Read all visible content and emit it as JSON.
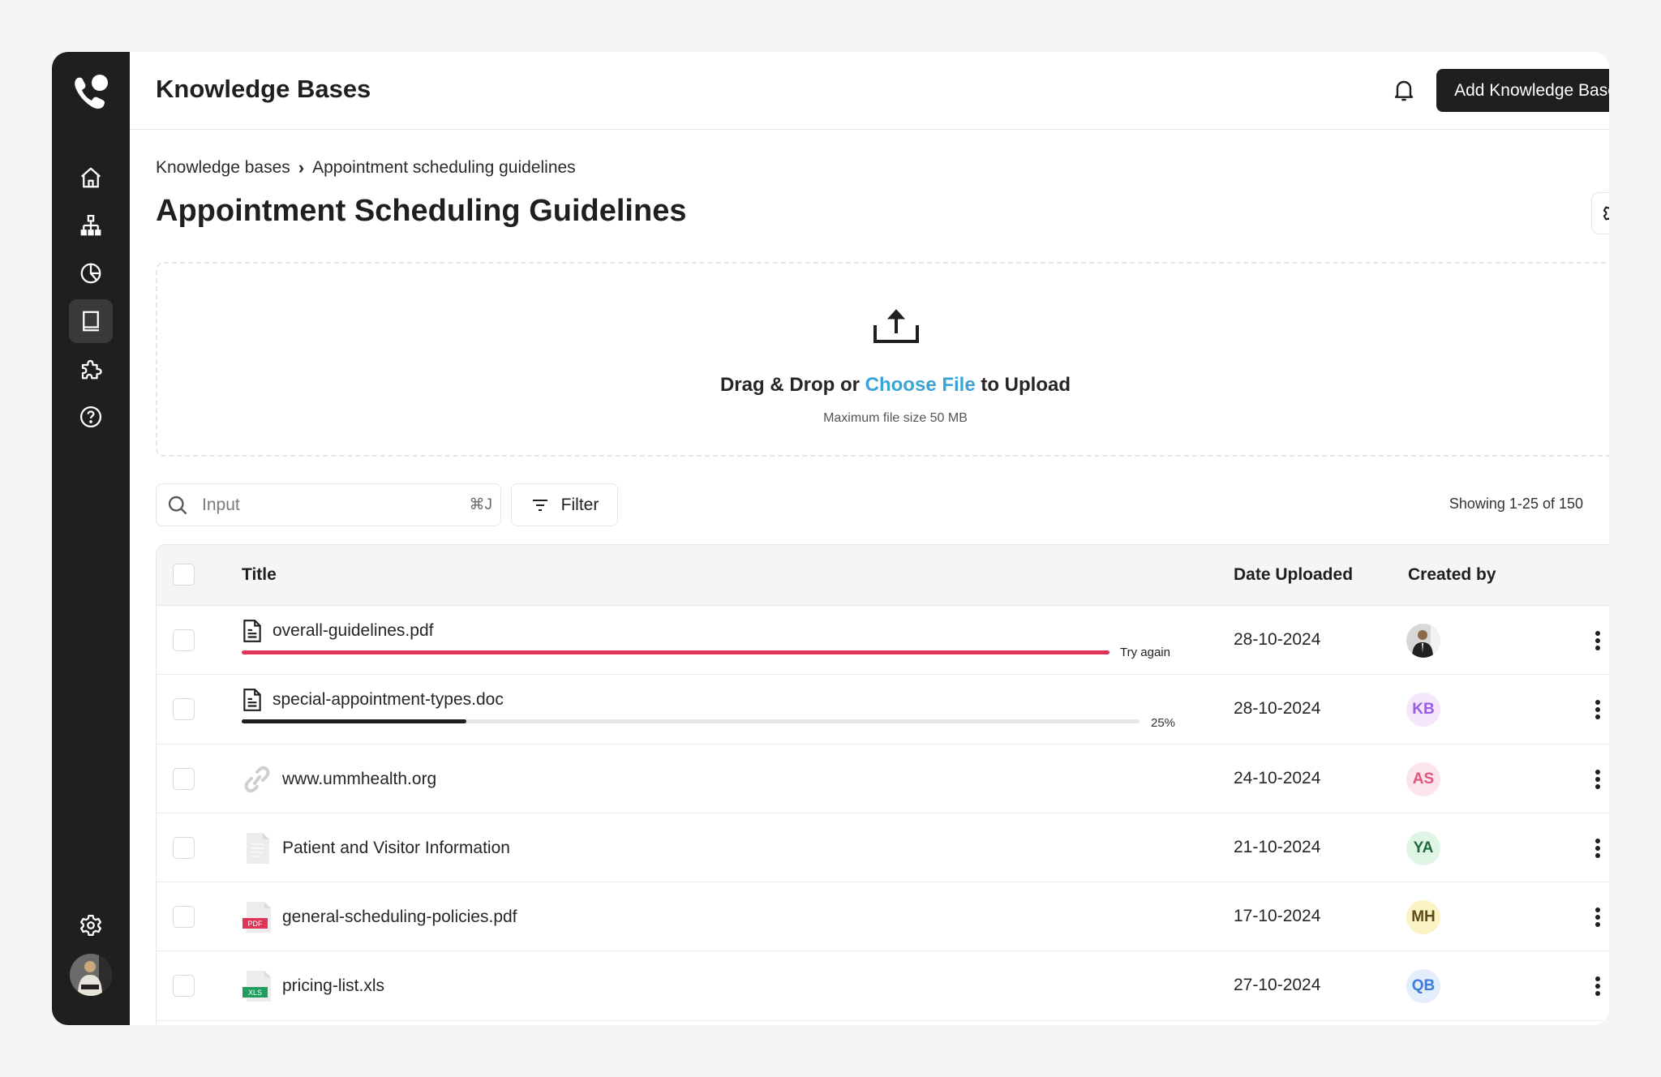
{
  "app": {
    "title": "Knowledge Bases",
    "add_button_label": "Add Knowledge Base"
  },
  "sidebar": {
    "items": [
      {
        "name": "home",
        "icon": "home-icon",
        "active": false
      },
      {
        "name": "hierarchy",
        "icon": "sitemap-icon",
        "active": false
      },
      {
        "name": "analytics",
        "icon": "pie-chart-icon",
        "active": false
      },
      {
        "name": "knowledge-bases",
        "icon": "book-icon",
        "active": true
      },
      {
        "name": "integrations",
        "icon": "puzzle-icon",
        "active": false
      },
      {
        "name": "help",
        "icon": "help-circle-icon",
        "active": false
      }
    ],
    "bottom": [
      {
        "name": "settings",
        "icon": "gear-icon"
      }
    ]
  },
  "breadcrumb": {
    "root": "Knowledge bases",
    "current": "Appointment scheduling guidelines",
    "separator": "›"
  },
  "page": {
    "title": "Appointment Scheduling Guidelines"
  },
  "upload": {
    "prefix": "Drag & Drop or ",
    "link": "Choose File",
    "suffix": " to Upload",
    "subtext": "Maximum file size 50 MB"
  },
  "search": {
    "placeholder": "Input",
    "value": "",
    "shortcut": "⌘J"
  },
  "filter": {
    "label": "Filter"
  },
  "pagination": {
    "showing": "Showing 1-25 of 150"
  },
  "table": {
    "columns": {
      "title": "Title",
      "date": "Date Uploaded",
      "created_by": "Created by"
    },
    "rows": [
      {
        "title": "overall-guidelines.pdf",
        "icon": "document-icon",
        "status": "failed",
        "status_label": "Try again",
        "progress": 100,
        "date": "28-10-2024",
        "creator": {
          "type": "photo",
          "initials": ""
        }
      },
      {
        "title": "special-appointment-types.doc",
        "icon": "document-icon",
        "status": "uploading",
        "status_label": "25%",
        "progress": 25,
        "date": "28-10-2024",
        "creator": {
          "type": "initials",
          "initials": "KB",
          "bg": "#f6e6fb",
          "fg": "#9b5de5"
        }
      },
      {
        "title": "www.ummhealth.org",
        "icon": "link-icon",
        "status": "done",
        "date": "24-10-2024",
        "creator": {
          "type": "initials",
          "initials": "AS",
          "bg": "#fce4ec",
          "fg": "#e0567a"
        }
      },
      {
        "title": "Patient and Visitor Information",
        "icon": "page-icon",
        "status": "done",
        "date": "21-10-2024",
        "creator": {
          "type": "initials",
          "initials": "YA",
          "bg": "#dff5e6",
          "fg": "#1e6b3c"
        }
      },
      {
        "title": "general-scheduling-policies.pdf",
        "icon": "pdf-icon",
        "badge": "PDF",
        "status": "done",
        "date": "17-10-2024",
        "creator": {
          "type": "initials",
          "initials": "MH",
          "bg": "#fbf3c4",
          "fg": "#5e4a17"
        }
      },
      {
        "title": "pricing-list.xls",
        "icon": "xls-icon",
        "badge": "XLS",
        "status": "done",
        "date": "27-10-2024",
        "creator": {
          "type": "initials",
          "initials": "QB",
          "bg": "#e3edfc",
          "fg": "#3b7ddd"
        }
      }
    ]
  },
  "colors": {
    "sidebar_bg": "#1f1f1f",
    "accent_link": "#3ba3d6",
    "error": "#e03358",
    "progress": "#1f1f1f",
    "pdf_badge": "#e03358",
    "xls_badge": "#1f9d5c"
  }
}
